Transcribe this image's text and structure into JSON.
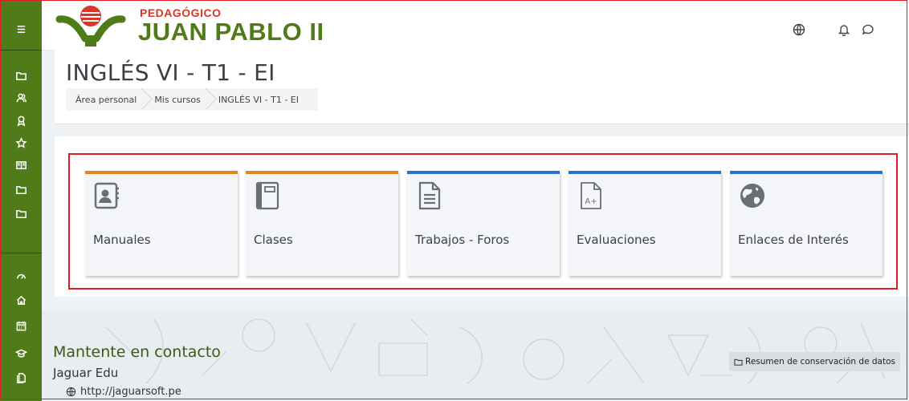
{
  "brand": {
    "subtitle": "PEDAGÓGICO",
    "name": "JUAN PABLO II",
    "colors": {
      "green": "#4f7b18",
      "red": "#d9362a"
    }
  },
  "sidebar": {
    "items": [
      {
        "icon": "menu-icon"
      },
      {
        "icon": "folder-icon"
      },
      {
        "icon": "users-icon"
      },
      {
        "icon": "badge-icon"
      },
      {
        "icon": "star-icon"
      },
      {
        "icon": "book-icon"
      },
      {
        "icon": "folder-icon"
      },
      {
        "icon": "folder-icon"
      },
      {
        "icon": "dashboard-icon"
      },
      {
        "icon": "home-icon"
      },
      {
        "icon": "calendar-icon"
      },
      {
        "icon": "graduation-cap-icon"
      },
      {
        "icon": "files-icon"
      }
    ]
  },
  "header_icons": [
    "globe-icon",
    "bell-icon",
    "chat-icon",
    "avatar"
  ],
  "page": {
    "title": "INGLÉS VI - T1 - EI",
    "breadcrumb": [
      "Área personal",
      "Mis cursos",
      "INGLÉS VI - T1 - EI"
    ]
  },
  "tiles": [
    {
      "label": "Manuales",
      "icon": "contact-book-icon",
      "accent": "#e0861c"
    },
    {
      "label": "Clases",
      "icon": "notebook-icon",
      "accent": "#e0861c"
    },
    {
      "label": "Trabajos - Foros",
      "icon": "document-icon",
      "accent": "#2a6fc9"
    },
    {
      "label": "Evaluaciones",
      "icon": "grade-document-icon",
      "accent": "#2a6fc9"
    },
    {
      "label": "Enlaces de Interés",
      "icon": "globe-icon",
      "accent": "#2a6fc9"
    }
  ],
  "footer": {
    "title": "Mantente en contacto",
    "org": "Jaguar Edu",
    "link": "http://jaguarsoft.pe",
    "data_button": "Resumen de conservación de datos"
  }
}
